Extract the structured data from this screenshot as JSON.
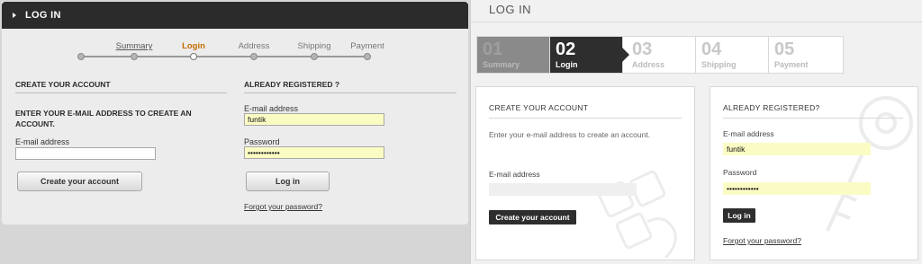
{
  "left": {
    "header_title": "LOG IN",
    "steps": [
      {
        "label": "Summary",
        "state": "link"
      },
      {
        "label": "Login",
        "state": "active"
      },
      {
        "label": "Address",
        "state": "inactive"
      },
      {
        "label": "Shipping",
        "state": "inactive"
      },
      {
        "label": "Payment",
        "state": "inactive"
      }
    ],
    "create": {
      "title": "CREATE YOUR ACCOUNT",
      "intro": "ENTER YOUR E-MAIL ADDRESS TO CREATE AN ACCOUNT.",
      "email_label": "E-mail address",
      "email_value": "",
      "button": "Create your account"
    },
    "registered": {
      "title": "ALREADY REGISTERED ?",
      "email_label": "E-mail address",
      "email_value": "funtik",
      "password_label": "Password",
      "password_value": "••••••••••••",
      "button": "Log in",
      "forgot": "Forgot your password?"
    }
  },
  "right": {
    "title": "LOG IN",
    "steps": [
      {
        "num": "01",
        "label": "Summary",
        "state": "done"
      },
      {
        "num": "02",
        "label": "Login",
        "state": "current"
      },
      {
        "num": "03",
        "label": "Address",
        "state": "inactive"
      },
      {
        "num": "04",
        "label": "Shipping",
        "state": "inactive"
      },
      {
        "num": "05",
        "label": "Payment",
        "state": "inactive"
      }
    ],
    "create": {
      "title": "CREATE YOUR ACCOUNT",
      "intro": "Enter your e-mail address to create an account.",
      "email_label": "E-mail address",
      "email_value": "",
      "button": "Create your account"
    },
    "registered": {
      "title": "ALREADY REGISTERED?",
      "email_label": "E-mail address",
      "email_value": "funtik",
      "password_label": "Password",
      "password_value": "••••••••••••",
      "button": "Log in",
      "forgot": "Forgot your password?"
    }
  },
  "colors": {
    "dark_header": "#2b2b2b",
    "active_step": "#c46d00",
    "autofill_yellow": "#fbfcc4",
    "current_step_bg": "#2e2e2e"
  }
}
